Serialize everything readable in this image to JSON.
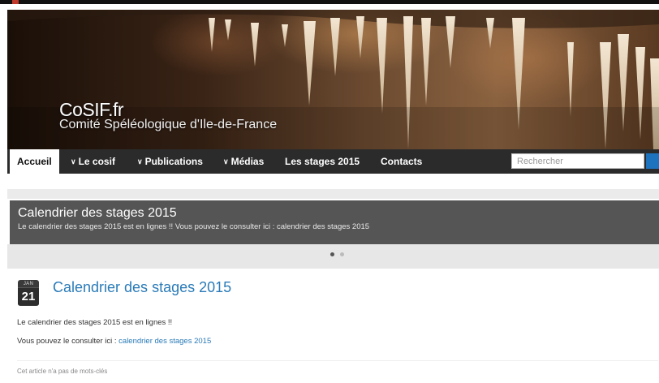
{
  "header": {
    "title": "CoSIF.fr",
    "subtitle": "Comité Spéléologique d'Ile-de-France"
  },
  "nav": {
    "items": [
      {
        "label": "Accueil",
        "active": true,
        "dropdown": false
      },
      {
        "label": "Le cosif",
        "active": false,
        "dropdown": true
      },
      {
        "label": "Publications",
        "active": false,
        "dropdown": true
      },
      {
        "label": "Médias",
        "active": false,
        "dropdown": true
      },
      {
        "label": "Les stages 2015",
        "active": false,
        "dropdown": false
      },
      {
        "label": "Contacts",
        "active": false,
        "dropdown": false
      }
    ],
    "search_placeholder": "Rechercher"
  },
  "slider": {
    "title": "Calendrier des stages 2015",
    "text": "Le calendrier des stages 2015 est en lignes !! Vous pouvez le consulter ici : calendrier des stages 2015",
    "slide_count": 2,
    "active_slide": 1
  },
  "article": {
    "date_month": "JAN",
    "date_day": "21",
    "title": "Calendrier des stages 2015",
    "paragraph1": "Le calendrier des stages 2015 est en lignes !!",
    "paragraph2_prefix": "Vous pouvez le consulter ici : ",
    "paragraph2_link": "calendrier des stages 2015",
    "tags_note": "Cet article n'a pas de mots-clés"
  },
  "colors": {
    "nav_background": "#2b2b2b",
    "slider_background": "#555555",
    "link": "#2a7bb8",
    "search_button": "#1e73be"
  },
  "icons": {
    "dropdown": "chevron-down-icon",
    "date": "calendar-date-icon"
  }
}
